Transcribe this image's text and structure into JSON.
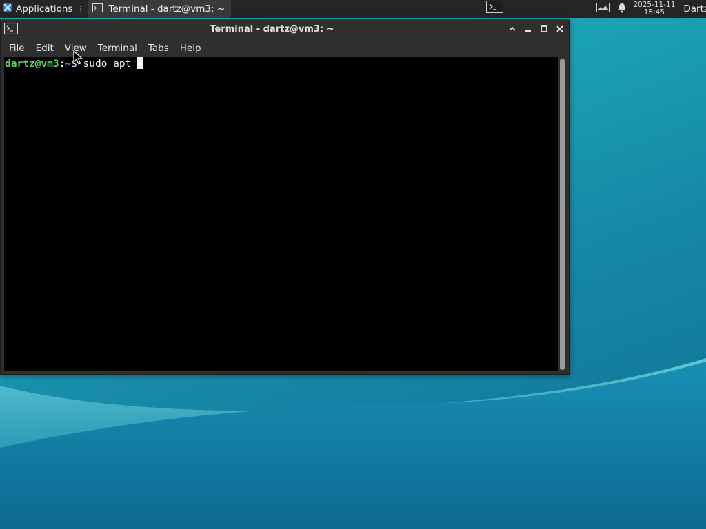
{
  "panel": {
    "applications_label": "Applications",
    "separator": "⋮",
    "task_title": "Terminal - dartz@vm3: ~",
    "clock_date": "2025-11-11",
    "clock_time": "18:45",
    "user_name": "Dartz",
    "icons": {
      "apps": "xfce-mouse-icon",
      "task": "terminal-icon",
      "launcher": "terminal-launcher-icon",
      "network": "network-icon",
      "notifications": "bell-icon"
    }
  },
  "window": {
    "title": "Terminal - dartz@vm3: ~",
    "menu": [
      "File",
      "Edit",
      "View",
      "Terminal",
      "Tabs",
      "Help"
    ]
  },
  "terminal": {
    "prompt_user": "dartz@vm3",
    "prompt_colon": ":",
    "prompt_dir": "~",
    "prompt_symbol": "$ ",
    "command": "sudo apt "
  },
  "colors": {
    "prompt_user": "#5fd35f",
    "prompt_dir": "#5c7cfa",
    "terminal_bg": "#000000",
    "panel_bg": "#252525"
  }
}
